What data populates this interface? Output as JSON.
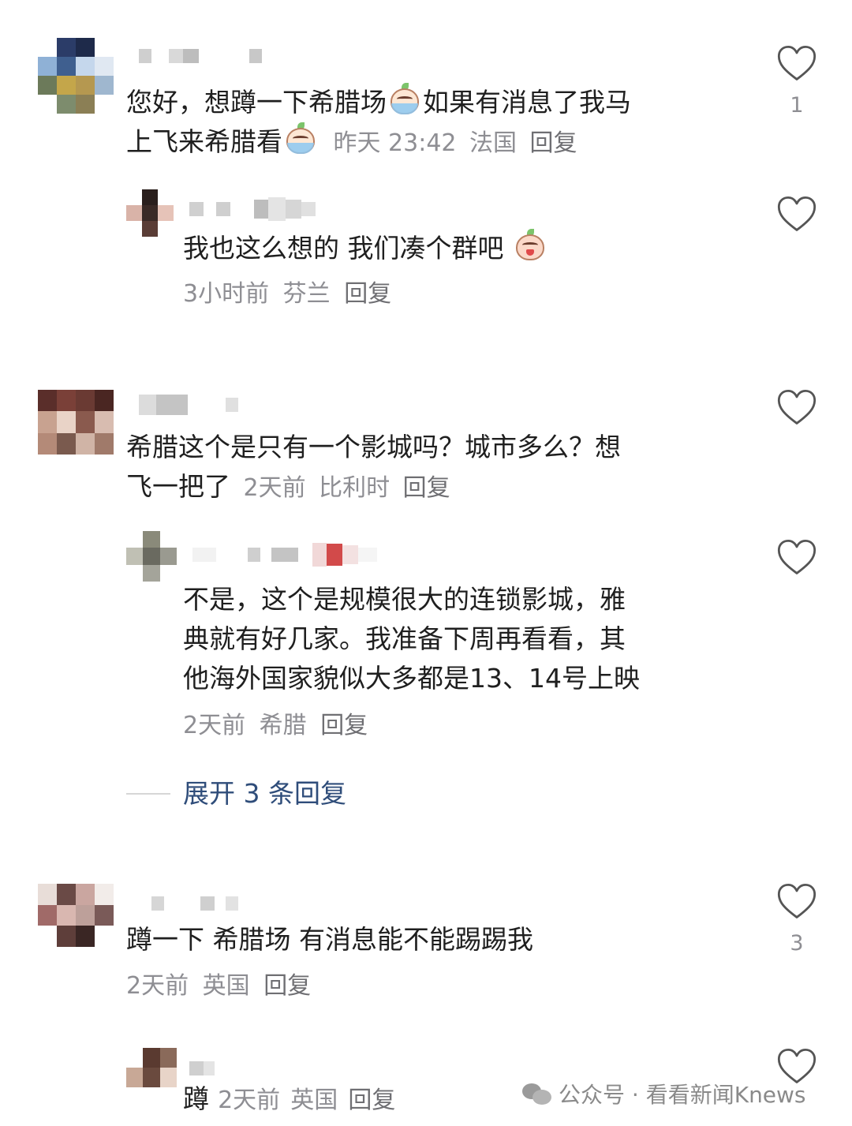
{
  "comments": [
    {
      "text1": "您好，想蹲一下希腊场",
      "text2": "如果有消息了我马",
      "text3": "上飞来希腊看",
      "time": "昨天 23:42",
      "location": "法国",
      "reply_label": "回复",
      "likes": "1",
      "replies": [
        {
          "text": "我也这么想的 我们凑个群吧",
          "time": "3小时前",
          "location": "芬兰",
          "reply_label": "回复"
        }
      ]
    },
    {
      "text1": "希腊这个是只有一个影城吗？城市多么？想",
      "text2": "飞一把了",
      "time": "2天前",
      "location": "比利时",
      "reply_label": "回复",
      "replies": [
        {
          "line1": "不是，这个是规模很大的连锁影城，雅",
          "line2": "典就有好几家。我准备下周再看看，其",
          "line3": "他海外国家貌似大多都是13、14号上映",
          "time": "2天前",
          "location": "希腊",
          "reply_label": "回复"
        }
      ],
      "expand_label": "展开 3 条回复"
    },
    {
      "text": "蹲一下 希腊场 有消息能不能踢踢我",
      "time": "2天前",
      "location": "英国",
      "reply_label": "回复",
      "likes": "3",
      "replies": [
        {
          "text": "蹲",
          "time": "2天前",
          "location": "英国",
          "reply_label": "回复"
        }
      ]
    }
  ],
  "watermark": "公众号 · 看看新闻Knews",
  "icons": {
    "like": "heart-outline-icon",
    "emoji_cry": "crying-emoji-icon",
    "watermark": "wechat-icon"
  },
  "colors": {
    "text": "#1f1f1f",
    "meta": "#8e8e93",
    "expand": "#2f4d7a"
  }
}
